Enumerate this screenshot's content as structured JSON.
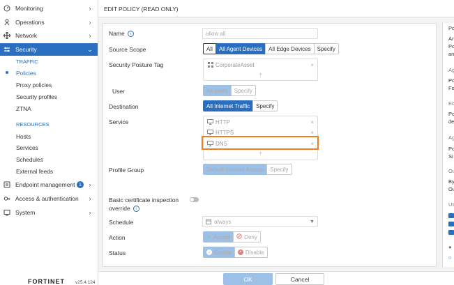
{
  "sidebar": {
    "items": [
      {
        "label": "Monitoring",
        "icon": "monitoring-icon"
      },
      {
        "label": "Operations",
        "icon": "operations-icon"
      },
      {
        "label": "Network",
        "icon": "network-icon"
      },
      {
        "label": "Security",
        "icon": "security-icon",
        "active": true
      },
      {
        "label": "Endpoint management",
        "icon": "endpoint-icon",
        "badge": "1"
      },
      {
        "label": "Access & authentication",
        "icon": "access-icon"
      },
      {
        "label": "System",
        "icon": "system-icon"
      }
    ],
    "traffic_heading": "TRAFFIC",
    "traffic_items": [
      "Policies",
      "Proxy policies",
      "Security profiles",
      "ZTNA"
    ],
    "resources_heading": "RESOURCES",
    "resource_items": [
      "Hosts",
      "Services",
      "Schedules",
      "External feeds"
    ],
    "logo": "FORTINET",
    "version": "v25.4.124"
  },
  "page": {
    "title": "EDIT POLICY (READ ONLY)"
  },
  "form": {
    "name_label": "Name",
    "name_placeholder": "allow all",
    "source_scope_label": "Source Scope",
    "source_scope_options": [
      "All",
      "All Agent Devices",
      "All Edge Devices",
      "Specify"
    ],
    "posture_label": "Security Posture Tag",
    "posture_value": "CorporateAsset",
    "user_label": "User",
    "user_options": [
      "All users",
      "Specify"
    ],
    "destination_label": "Destination",
    "destination_options": [
      "All Internet Traffic",
      "Specify"
    ],
    "service_label": "Service",
    "services": [
      "HTTP",
      "HTTPS",
      "DNS"
    ],
    "profile_group_label": "Profile Group",
    "profile_group_options": [
      "Default Internet Access",
      "Specify"
    ],
    "cert_label_1": "Basic certificate inspection",
    "cert_label_2": "override",
    "schedule_label": "Schedule",
    "schedule_value": "always",
    "action_label": "Action",
    "action_options": [
      "Accept",
      "Deny"
    ],
    "status_label": "Status",
    "status_options": [
      "Enable",
      "Disable"
    ],
    "plus": "+",
    "remove": "×"
  },
  "right_pane": [
    "Po",
    "An",
    "Po",
    "an",
    "Ag",
    "Po",
    "Fo",
    "Ed",
    "Po",
    "de",
    "Ag",
    "Po",
    "Si",
    "Ou",
    "By",
    "Ou",
    "Us"
  ],
  "footer": {
    "ok": "OK",
    "cancel": "Cancel"
  },
  "colors": {
    "accent": "#2a6ebf",
    "highlight": "#f07d1e",
    "accent_light": "#9cc0e6"
  }
}
